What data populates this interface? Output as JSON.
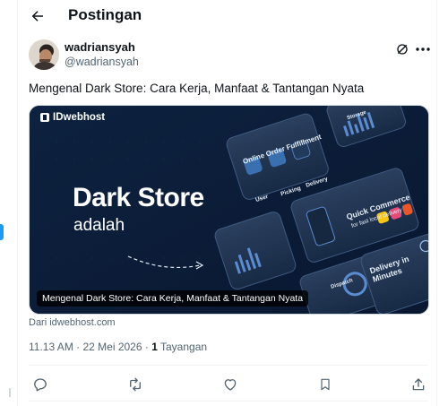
{
  "header": {
    "title": "Postingan",
    "back_icon": "arrow-left-icon"
  },
  "post": {
    "author_name": "wadriansyah",
    "author_handle": "@wadriansyah",
    "text": "Mengenal Dark Store: Cara Kerja, Manfaat & Tantangan Nyata",
    "card": {
      "brand": "IDwebhost",
      "hero_title": "Dark Store",
      "hero_subtitle": "adalah",
      "caption": "Mengenal Dark Store: Cara Kerja, Manfaat & Tantangan Nyata",
      "panels": {
        "fulfillment": "Online Order Fulfillment",
        "user": "User",
        "picking": "Picking",
        "delivery": "Delivery",
        "quick_commerce": "Quick Commerce",
        "quick_commerce_sub": "for fast local delivery",
        "delivery_minutes": "Delivery in Minutes",
        "storage": "Storage",
        "dispatch": "Dispatch"
      }
    },
    "source": "Dari idwebhost.com",
    "timestamp": "11.13 AM · 22 Mei 2026 · ",
    "views_count": "1",
    "views_label": " Tayangan"
  },
  "colors": {
    "accent": "#1d9bf0",
    "text": "#0f1419",
    "muted": "#536471",
    "card_bg": "#0b1d36"
  }
}
